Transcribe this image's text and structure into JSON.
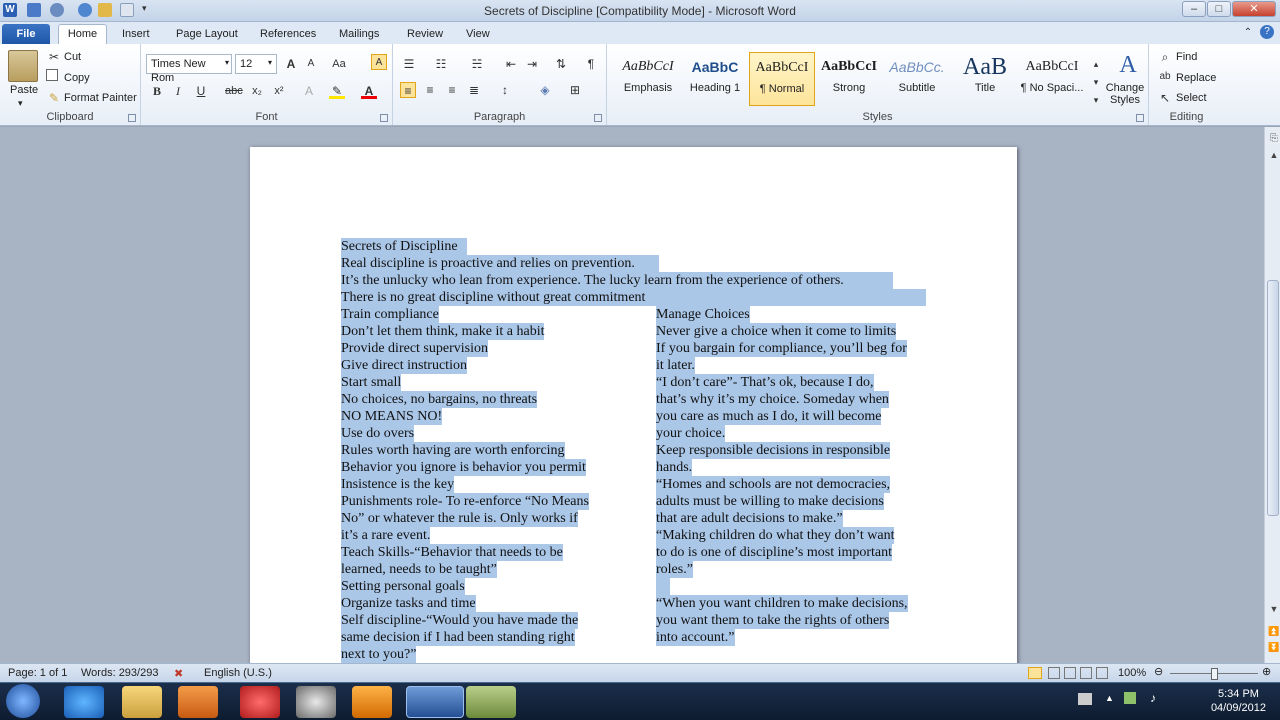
{
  "window": {
    "title": "Secrets of Discipline [Compatibility Mode] - Microsoft Word",
    "controls": {
      "minimize": "‒",
      "maximize": "□",
      "close": "✕"
    }
  },
  "tabs": [
    "File",
    "Home",
    "Insert",
    "Page Layout",
    "References",
    "Mailings",
    "Review",
    "View"
  ],
  "ribbon": {
    "clipboard": {
      "label": "Clipboard",
      "paste": "Paste",
      "cut": "Cut",
      "copy": "Copy",
      "format_painter": "Format Painter"
    },
    "font": {
      "label": "Font",
      "font_name": "Times New Rom",
      "font_size": "12"
    },
    "paragraph": {
      "label": "Paragraph"
    },
    "styles": {
      "label": "Styles",
      "items": [
        {
          "sample": "AaBbCcI",
          "name": "Emphasis"
        },
        {
          "sample": "AaBbC",
          "name": "Heading 1"
        },
        {
          "sample": "AaBbCcI",
          "name": "¶ Normal"
        },
        {
          "sample": "AaBbCcI",
          "name": "Strong"
        },
        {
          "sample": "AaBbCc.",
          "name": "Subtitle"
        },
        {
          "sample": "AaB",
          "name": "Title"
        },
        {
          "sample": "AaBbCcI",
          "name": "¶ No Spaci..."
        }
      ],
      "change_styles": "Change Styles"
    },
    "editing": {
      "label": "Editing",
      "find": "Find",
      "replace": "Replace",
      "select": "Select"
    }
  },
  "document": {
    "header_lines": [
      "Secrets of Discipline",
      "Real discipline is proactive and relies on prevention.",
      "It’s the unlucky who lean from experience. The lucky learn from the experience of others.",
      "There is no great discipline without great commitment"
    ],
    "col1": [
      "Train compliance",
      "Don’t let them think, make it a habit",
      "Provide direct supervision",
      "Give direct instruction",
      "Start small",
      "No choices, no bargains, no threats",
      "NO MEANS NO!",
      "Use do overs",
      "Rules worth having are worth enforcing",
      "Behavior you ignore is behavior you permit",
      "Insistence is the key",
      "Punishments role- To re-enforce “No Means",
      "No” or whatever the rule is. Only works if",
      "it’s a rare event.",
      "Teach Skills-“Behavior that needs to be",
      "learned, needs to be taught”",
      "Setting personal goals",
      "Organize tasks and time",
      "Self discipline-“Would you have made the",
      "same decision if I had been standing right",
      "next to you?”"
    ],
    "col2": [
      "Manage Choices",
      "Never give a choice when it come to limits",
      "If you bargain for compliance, you’ll beg for",
      "it later.",
      "“I don’t care”- That’s ok, because I do,",
      "that’s why it’s my choice. Someday when",
      "you care as much as I do, it will become",
      "your choice.",
      "Keep responsible decisions in responsible",
      "hands.",
      "“Homes and schools are not democracies,",
      "adults must be willing to make decisions",
      "that are adult decisions to make.”",
      "“Making children do what they don’t want",
      "to do is one of discipline’s most important",
      "roles.”",
      "",
      "“When you want children to make decisions,",
      "you want them to take the rights of others",
      "into account.”"
    ]
  },
  "status": {
    "page": "Page: 1 of 1",
    "words": "Words: 293/293",
    "language": "English (U.S.)",
    "zoom": "100%"
  },
  "taskbar": {
    "time": "5:34 PM",
    "date": "04/09/2012"
  },
  "colors": {
    "selection": "#abc7e8",
    "ribbon": "#e7eef7",
    "file_tab": "#1f57a8"
  }
}
